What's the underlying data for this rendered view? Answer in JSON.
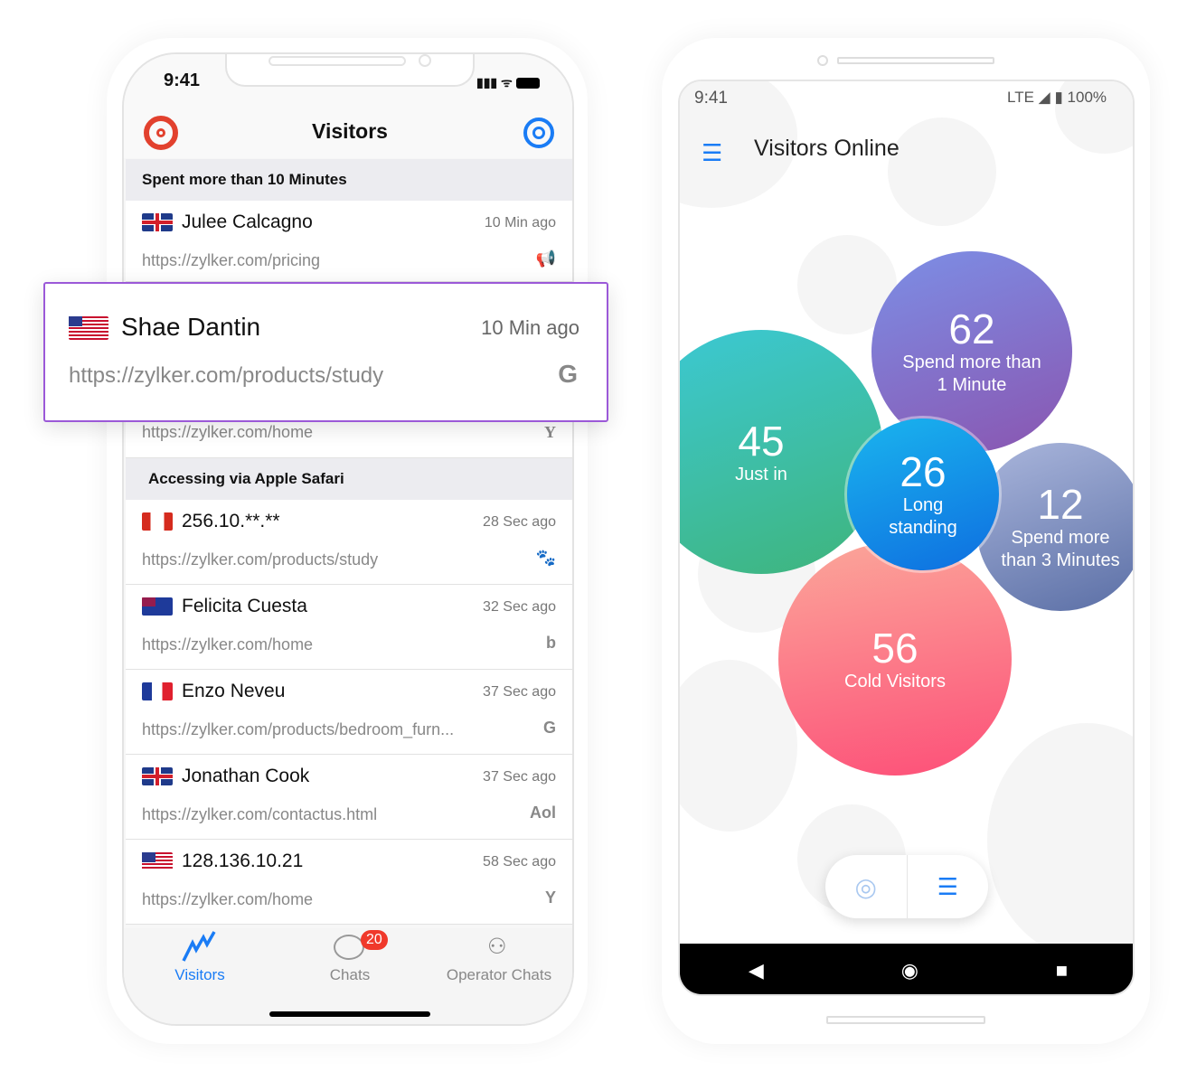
{
  "ios": {
    "time": "9:41",
    "title": "Visitors",
    "sections": [
      "Spent more than 10 Minutes",
      "Accessing via Apple Safari"
    ],
    "rows": [
      {
        "flag": "uk",
        "name": "Julee Calcagno",
        "time": "10 Min ago",
        "url": "https://zylker.com/pricing",
        "source": "megaphone-icon",
        "glyph": "📢"
      },
      {
        "flag": "ca",
        "name": "256.10.**.**",
        "time": "28 Sec ago",
        "url": "https://zylker.com/products/study",
        "source": "paw-icon",
        "glyph": "🐾"
      },
      {
        "flag": "au",
        "name": "Felicita Cuesta",
        "time": "32 Sec ago",
        "url": "https://zylker.com/home",
        "source": "bing-icon",
        "glyph": "b"
      },
      {
        "flag": "fr",
        "name": "Enzo Neveu",
        "time": "37 Sec ago",
        "url": "https://zylker.com/products/bedroom_furn...",
        "source": "google-icon",
        "glyph": "G"
      },
      {
        "flag": "uk",
        "name": "Jonathan Cook",
        "time": "37 Sec ago",
        "url": "https://zylker.com/contactus.html",
        "source": "aol-icon",
        "glyph": "Aol"
      },
      {
        "flag": "us",
        "name": "128.136.10.21",
        "time": "58 Sec ago",
        "url": "https://zylker.com/home",
        "source": "yahoo-icon",
        "glyph": "Y"
      }
    ],
    "hidden_row": {
      "url": "https://zylker.com/home",
      "glyph": "Y"
    },
    "popup": {
      "name": "Shae Dantin",
      "time": "10 Min ago",
      "url": "https://zylker.com/products/study",
      "glyph": "G"
    },
    "tabs": {
      "visitors": "Visitors",
      "chats": "Chats",
      "chats_badge": "20",
      "operator": "Operator Chats"
    },
    "accent": "#1a7cf5"
  },
  "android": {
    "time": "9:41",
    "network": "LTE",
    "battery": "100%",
    "title": "Visitors Online",
    "bubbles": {
      "just_in": {
        "n": "45",
        "l": "Just in"
      },
      "one_min": {
        "n": "62",
        "l": "Spend more than 1 Minute"
      },
      "long": {
        "n": "26",
        "l": "Long standing"
      },
      "three_min": {
        "n": "12",
        "l": "Spend more than 3 Minutes"
      },
      "cold": {
        "n": "56",
        "l": "Cold Visitors"
      }
    }
  }
}
